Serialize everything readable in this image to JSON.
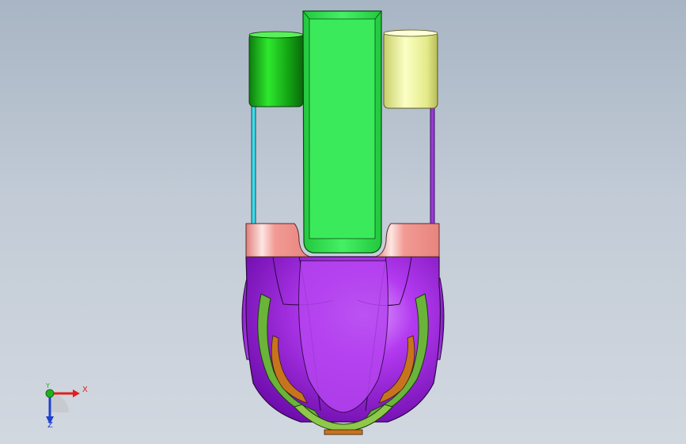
{
  "triad": {
    "x_label": "X",
    "y_label": "Y",
    "z_label": "Z",
    "x_color": "#e02020",
    "y_color": "#20b020",
    "z_color": "#2040d0"
  },
  "colors": {
    "bracket": "#2de24e",
    "left_roller": "#1fc21f",
    "right_roller": "#f2f7a6",
    "collar": "#f3a09a",
    "body": "#a520e8",
    "inner_band": "#6ab43a",
    "inner_core": "#c8741e",
    "left_rod": "#3fd9e8",
    "right_rod": "#9a38d6"
  }
}
